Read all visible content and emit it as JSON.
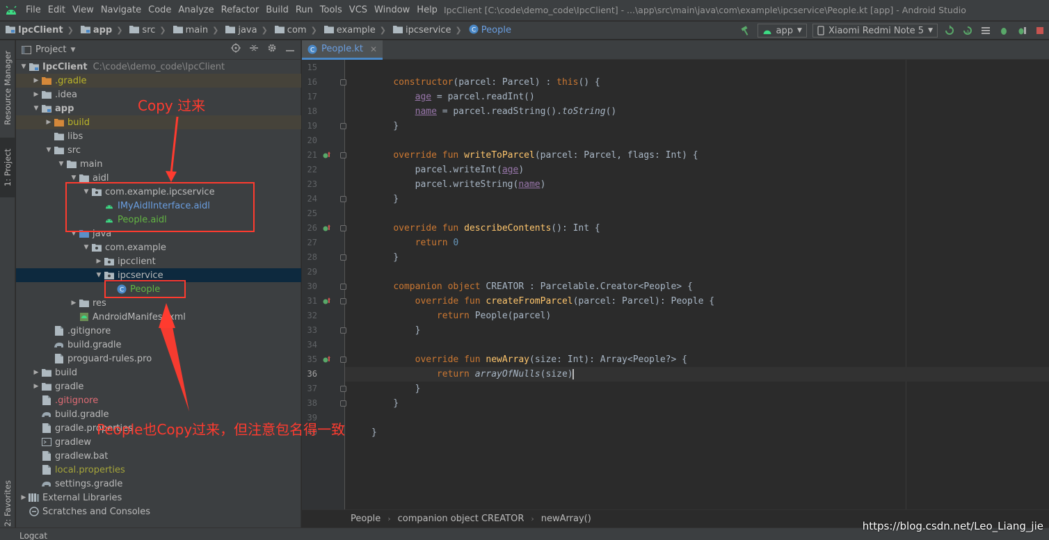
{
  "menubar": {
    "items": [
      "File",
      "Edit",
      "View",
      "Navigate",
      "Code",
      "Analyze",
      "Refactor",
      "Build",
      "Run",
      "Tools",
      "VCS",
      "Window",
      "Help"
    ],
    "title": "IpcClient [C:\\code\\demo_code\\IpcClient] - ...\\app\\src\\main\\java\\com\\example\\ipcservice\\People.kt [app] - Android Studio"
  },
  "navbar": {
    "crumbs": [
      "IpcClient",
      "app",
      "src",
      "main",
      "java",
      "com",
      "example",
      "ipcservice",
      "People"
    ],
    "run_config": "app",
    "device": "Xiaomi Redmi Note 5"
  },
  "left_stripe": {
    "resource_manager": "Resource Manager",
    "project": "1: Project",
    "favorites": "2: Favorites"
  },
  "project_panel": {
    "title": "Project",
    "tree": [
      {
        "label": "IpcClient",
        "extra": "C:\\code\\demo_code\\IpcClient",
        "depth": 0,
        "arrow": "down",
        "icon": "module-folder-icon",
        "style": "bold"
      },
      {
        "label": ".gradle",
        "depth": 1,
        "arrow": "right",
        "icon": "folder-orange-icon",
        "style": "yellow",
        "excluded": true
      },
      {
        "label": ".idea",
        "depth": 1,
        "arrow": "right",
        "icon": "folder-icon",
        "style": "normal"
      },
      {
        "label": "app",
        "depth": 1,
        "arrow": "down",
        "icon": "module-folder-icon",
        "style": "bold"
      },
      {
        "label": "build",
        "depth": 2,
        "arrow": "right",
        "icon": "folder-orange-icon",
        "style": "yellow",
        "excluded": true
      },
      {
        "label": "libs",
        "depth": 2,
        "arrow": "",
        "icon": "folder-icon",
        "style": "normal"
      },
      {
        "label": "src",
        "depth": 2,
        "arrow": "down",
        "icon": "folder-icon",
        "style": "normal"
      },
      {
        "label": "main",
        "depth": 3,
        "arrow": "down",
        "icon": "folder-icon",
        "style": "normal"
      },
      {
        "label": "aidl",
        "depth": 4,
        "arrow": "down",
        "icon": "folder-icon",
        "style": "normal"
      },
      {
        "label": "com.example.ipcservice",
        "depth": 5,
        "arrow": "down",
        "icon": "package-icon",
        "style": "normal"
      },
      {
        "label": "IMyAidlInterface.aidl",
        "depth": 6,
        "arrow": "",
        "icon": "android-icon",
        "style": "blue"
      },
      {
        "label": "People.aidl",
        "depth": 6,
        "arrow": "",
        "icon": "android-icon",
        "style": "green"
      },
      {
        "label": "java",
        "depth": 4,
        "arrow": "down",
        "icon": "folder-blue-icon",
        "style": "normal"
      },
      {
        "label": "com.example",
        "depth": 5,
        "arrow": "down",
        "icon": "package-icon",
        "style": "normal"
      },
      {
        "label": "ipcclient",
        "depth": 6,
        "arrow": "right",
        "icon": "package-icon",
        "style": "normal"
      },
      {
        "label": "ipcservice",
        "depth": 6,
        "arrow": "down",
        "icon": "package-icon",
        "style": "normal",
        "selected": true
      },
      {
        "label": "People",
        "depth": 7,
        "arrow": "",
        "icon": "kotlin-class-icon",
        "style": "green"
      },
      {
        "label": "res",
        "depth": 4,
        "arrow": "right",
        "icon": "folder-icon",
        "style": "normal"
      },
      {
        "label": "AndroidManifest.xml",
        "depth": 4,
        "arrow": "",
        "icon": "manifest-icon",
        "style": "normal"
      },
      {
        "label": ".gitignore",
        "depth": 2,
        "arrow": "",
        "icon": "file-icon",
        "style": "normal"
      },
      {
        "label": "build.gradle",
        "depth": 2,
        "arrow": "",
        "icon": "gradle-icon",
        "style": "normal"
      },
      {
        "label": "proguard-rules.pro",
        "depth": 2,
        "arrow": "",
        "icon": "file-icon",
        "style": "normal"
      },
      {
        "label": "build",
        "depth": 1,
        "arrow": "right",
        "icon": "folder-icon",
        "style": "normal"
      },
      {
        "label": "gradle",
        "depth": 1,
        "arrow": "right",
        "icon": "folder-icon",
        "style": "normal"
      },
      {
        "label": ".gitignore",
        "depth": 1,
        "arrow": "",
        "icon": "file-icon",
        "style": "red"
      },
      {
        "label": "build.gradle",
        "depth": 1,
        "arrow": "",
        "icon": "gradle-icon",
        "style": "normal"
      },
      {
        "label": "gradle.properties",
        "depth": 1,
        "arrow": "",
        "icon": "file-icon",
        "style": "normal"
      },
      {
        "label": "gradlew",
        "depth": 1,
        "arrow": "",
        "icon": "terminal-icon",
        "style": "normal"
      },
      {
        "label": "gradlew.bat",
        "depth": 1,
        "arrow": "",
        "icon": "file-icon",
        "style": "normal"
      },
      {
        "label": "local.properties",
        "depth": 1,
        "arrow": "",
        "icon": "file-icon",
        "style": "olive"
      },
      {
        "label": "settings.gradle",
        "depth": 1,
        "arrow": "",
        "icon": "gradle-icon",
        "style": "normal"
      },
      {
        "label": "External Libraries",
        "depth": 0,
        "arrow": "right",
        "icon": "library-icon",
        "style": "normal"
      },
      {
        "label": "Scratches and Consoles",
        "depth": 0,
        "arrow": "",
        "icon": "scratch-icon",
        "style": "normal"
      }
    ]
  },
  "editor": {
    "tab_label": "People.kt",
    "current_line": 36,
    "lines": [
      {
        "n": 15,
        "html": ""
      },
      {
        "n": 16,
        "fold": true,
        "html": "    <span class='kw'>constructor</span>(parcel: Parcel) : <span class='kw'>this</span>() {"
      },
      {
        "n": 17,
        "html": "        <span class='prop'>age</span> = parcel.readInt()"
      },
      {
        "n": 18,
        "html": "        <span class='prop'>name</span> = parcel.readString().<span class='it'>toString</span>()"
      },
      {
        "n": 19,
        "fold": true,
        "html": "    }"
      },
      {
        "n": 20,
        "html": ""
      },
      {
        "n": 21,
        "fold": true,
        "mark": true,
        "html": "    <span class='kw'>override fun </span><span class='fn'>writeToParcel</span>(parcel: Parcel, flags: Int) {"
      },
      {
        "n": 22,
        "html": "        parcel.writeInt(<span class='prop'>age</span>)"
      },
      {
        "n": 23,
        "html": "        parcel.writeString(<span class='prop'>name</span>)"
      },
      {
        "n": 24,
        "fold": true,
        "html": "    }"
      },
      {
        "n": 25,
        "html": ""
      },
      {
        "n": 26,
        "fold": true,
        "mark": true,
        "html": "    <span class='kw'>override fun </span><span class='fn'>describeContents</span>(): Int {"
      },
      {
        "n": 27,
        "html": "        <span class='kw'>return </span><span class='num'>0</span>"
      },
      {
        "n": 28,
        "fold": true,
        "html": "    }"
      },
      {
        "n": 29,
        "html": ""
      },
      {
        "n": 30,
        "fold": true,
        "html": "    <span class='kw'>companion object </span>CREATOR : Parcelable.Creator&lt;People&gt; {"
      },
      {
        "n": 31,
        "fold": true,
        "mark": true,
        "html": "        <span class='kw'>override fun </span><span class='fn'>createFromParcel</span>(parcel: Parcel): People {"
      },
      {
        "n": 32,
        "html": "            <span class='kw'>return </span>People(parcel)"
      },
      {
        "n": 33,
        "fold": true,
        "html": "        }"
      },
      {
        "n": 34,
        "html": ""
      },
      {
        "n": 35,
        "fold": true,
        "mark": true,
        "html": "        <span class='kw'>override fun </span><span class='fn'>newArray</span>(size: Int): Array&lt;People?&gt; {"
      },
      {
        "n": 36,
        "html": "            <span class='kw'>return </span><span class='it'>arrayOfNulls</span>(size)<span class='caret-bar'></span>"
      },
      {
        "n": 37,
        "fold": true,
        "html": "        }"
      },
      {
        "n": 38,
        "fold": true,
        "html": "    }"
      },
      {
        "n": 39,
        "html": ""
      },
      {
        "n": 40,
        "html": "}"
      }
    ]
  },
  "code_breadcrumb": [
    "People",
    "companion object CREATOR",
    "newArray()"
  ],
  "statusbar": {
    "logcat": "Logcat"
  },
  "watermark": "https://blog.csdn.net/Leo_Liang_jie",
  "annotations": {
    "copy_note": "Copy 过来",
    "people_note": "People也Copy过来，但注意包名得一致"
  },
  "colors": {
    "annotation": "#ff3b2f",
    "accent": "#4a88c7",
    "background": "#2b2b2b",
    "panel": "#3c3f41"
  }
}
